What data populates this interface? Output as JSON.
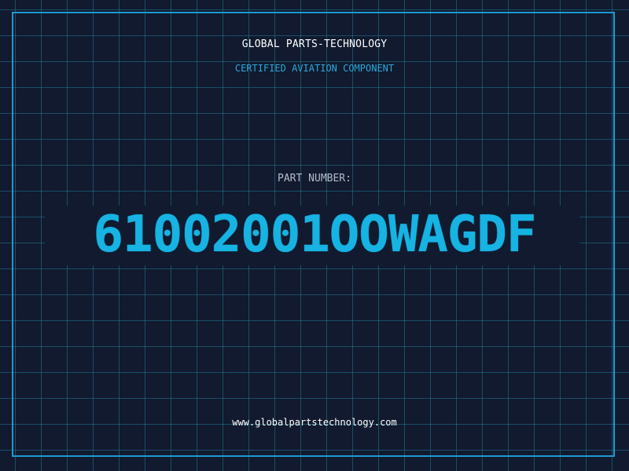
{
  "header": {
    "company_name": "GLOBAL PARTS-TECHNOLOGY",
    "subtitle": "CERTIFIED AVIATION COMPONENT"
  },
  "part": {
    "label": "PART NUMBER:",
    "number": "61002001OOWAGDF"
  },
  "footer": {
    "website": "www.globalpartstechnology.com"
  },
  "colors": {
    "background": "#111a2e",
    "grid": "#207896",
    "frame": "#1f9ad0",
    "accent": "#16b3e3",
    "subtitle": "#2aa8d8"
  }
}
